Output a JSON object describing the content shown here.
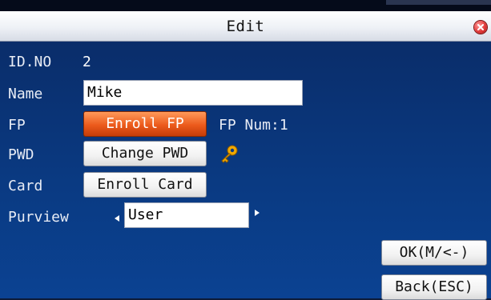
{
  "window": {
    "title": "Edit"
  },
  "form": {
    "id_label": "ID.NO",
    "id_value": "2",
    "name_label": "Name",
    "name_value": "Mike",
    "fp_label": "FP",
    "fp_button": "Enroll FP",
    "fp_num": "FP Num:1",
    "pwd_label": "PWD",
    "pwd_button": "Change PWD",
    "card_label": "Card",
    "card_button": "Enroll Card",
    "purview_label": "Purview",
    "purview_value": "User"
  },
  "actions": {
    "ok": "OK(M/<-)",
    "back": "Back(ESC)"
  },
  "icons": {
    "close": "close-icon",
    "key": "key-icon",
    "prev": "arrow-left-icon",
    "next": "arrow-right-icon"
  },
  "colors": {
    "accent": "#ec5a1c",
    "background": "#0a3a82",
    "key": "#f2a900"
  }
}
